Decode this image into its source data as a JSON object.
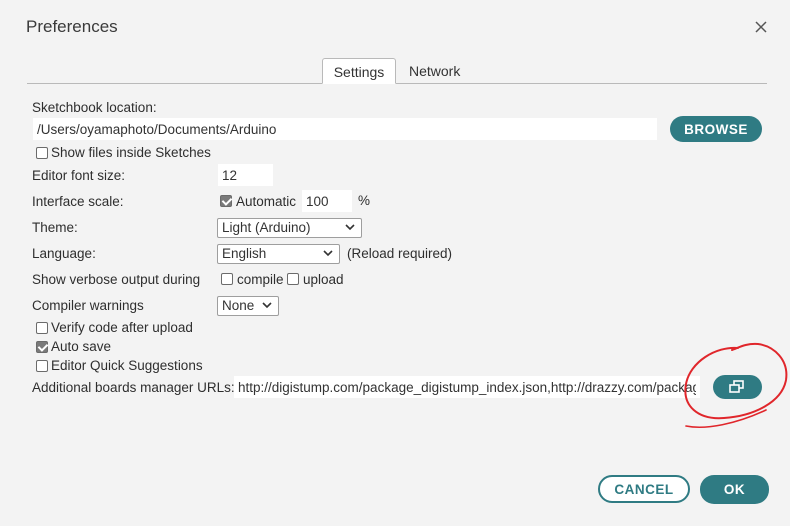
{
  "dialog": {
    "title": "Preferences"
  },
  "tabs": [
    {
      "label": "Settings",
      "active": true
    },
    {
      "label": "Network",
      "active": false
    }
  ],
  "sketchbook": {
    "label": "Sketchbook location:",
    "value": "/Users/oyamaphoto/Documents/Arduino",
    "browse_label": "BROWSE"
  },
  "show_files": {
    "label": "Show files inside Sketches",
    "checked": false
  },
  "font_size": {
    "label": "Editor font size:",
    "value": "12"
  },
  "interface_scale": {
    "label": "Interface scale:",
    "automatic_label": "Automatic",
    "automatic_checked": true,
    "value": "100",
    "unit": "%"
  },
  "theme": {
    "label": "Theme:",
    "selected": "Light (Arduino)"
  },
  "language": {
    "label": "Language:",
    "selected": "English",
    "note": "(Reload required)"
  },
  "verbose": {
    "label": "Show verbose output during",
    "compile_label": "compile",
    "compile_checked": false,
    "upload_label": "upload",
    "upload_checked": false
  },
  "compiler_warnings": {
    "label": "Compiler warnings",
    "selected": "None"
  },
  "verify_code": {
    "label": "Verify code after upload",
    "checked": false
  },
  "auto_save": {
    "label": "Auto save",
    "checked": true
  },
  "quick_suggestions": {
    "label": "Editor Quick Suggestions",
    "checked": false
  },
  "boards_urls": {
    "label": "Additional boards manager URLs:",
    "value": "http://digistump.com/package_digistump_index.json,http://drazzy.com/package_drazzy.com_index.json"
  },
  "footer": {
    "cancel_label": "CANCEL",
    "ok_label": "OK"
  },
  "colors": {
    "accent": "#2f7b83",
    "annotation": "#e0262b",
    "background": "#f3f3f3"
  }
}
